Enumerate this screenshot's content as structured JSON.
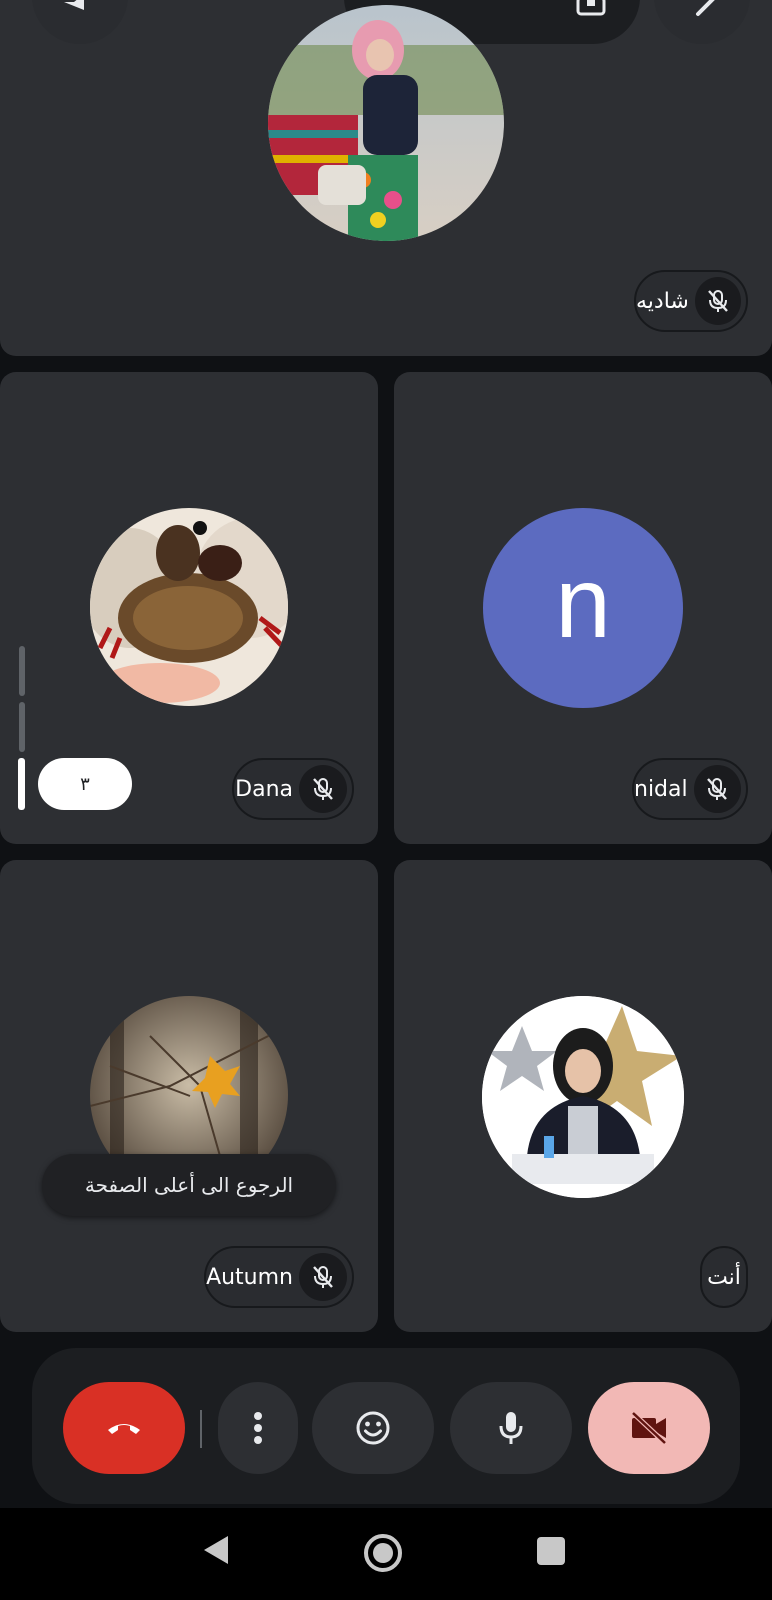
{
  "participants": {
    "top": {
      "name": "شاديه",
      "muted": true
    },
    "dana": {
      "name": "Dana",
      "muted": true
    },
    "nidal": {
      "name": "nidal",
      "initial": "n",
      "avatar_color": "#5c6bc0",
      "muted": true
    },
    "autumn": {
      "name": "Autumn",
      "muted": true
    },
    "self": {
      "name": "أنت"
    }
  },
  "page_indicator": {
    "label": "٣"
  },
  "tooltip": {
    "text": "الرجوع الى أعلى الصفحة"
  },
  "controls": {
    "end_call_color": "#d93025",
    "camera_off_bg": "#f2b8b5",
    "icons": [
      "phone-hangup-icon",
      "more-vert-icon",
      "emoji-icon",
      "microphone-icon",
      "video-off-icon"
    ]
  },
  "nav": {
    "icons": [
      "back-icon",
      "home-icon",
      "recents-icon"
    ]
  }
}
